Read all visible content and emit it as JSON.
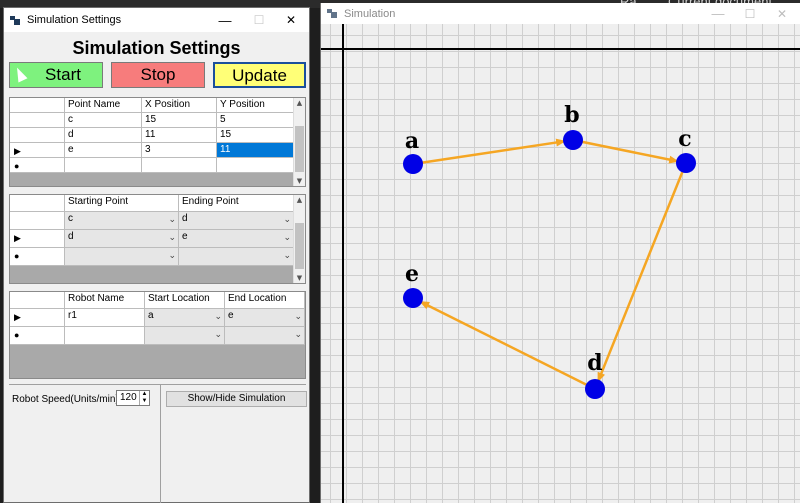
{
  "settings_window": {
    "title": "Simulation Settings",
    "heading": "Simulation Settings",
    "controls": {
      "minimize": "—",
      "maximize": "☐",
      "close": "✕"
    },
    "buttons": {
      "start": {
        "label": "Start",
        "color": "#7ef27e"
      },
      "stop": {
        "label": "Stop",
        "color": "#f77c7c"
      },
      "update": {
        "label": "Update",
        "color": "#ffff77"
      }
    },
    "points_grid": {
      "columns": [
        "Point Name",
        "X Position",
        "Y Position"
      ],
      "rows": [
        {
          "name": "c",
          "x": "15",
          "y": "5"
        },
        {
          "name": "d",
          "x": "11",
          "y": "15"
        },
        {
          "name": "e",
          "x": "3",
          "y": "11"
        }
      ]
    },
    "paths_grid": {
      "columns": [
        "Starting Point",
        "Ending Point"
      ],
      "rows": [
        {
          "start": "c",
          "end": "d"
        },
        {
          "start": "d",
          "end": "e"
        },
        {
          "start": "",
          "end": ""
        }
      ]
    },
    "robots_grid": {
      "columns": [
        "Robot Name",
        "Start Location",
        "End Location"
      ],
      "rows": [
        {
          "name": "r1",
          "start": "a",
          "end": "e"
        },
        {
          "name": "",
          "start": "",
          "end": ""
        }
      ]
    },
    "speed": {
      "label": "Robot Speed(Units/min)",
      "value": "120"
    },
    "show_hide_label": "Show/Hide Simulation"
  },
  "simulation_window": {
    "title": "Simulation",
    "nodes": [
      "a",
      "b",
      "c",
      "d",
      "e"
    ],
    "edges": [
      [
        "a",
        "b"
      ],
      [
        "b",
        "c"
      ],
      [
        "c",
        "d"
      ],
      [
        "d",
        "e"
      ]
    ],
    "node_color": "#0000e6",
    "edge_color": "#f5a623"
  },
  "background_text": {
    "left": "Ra",
    "right": "Current document"
  }
}
